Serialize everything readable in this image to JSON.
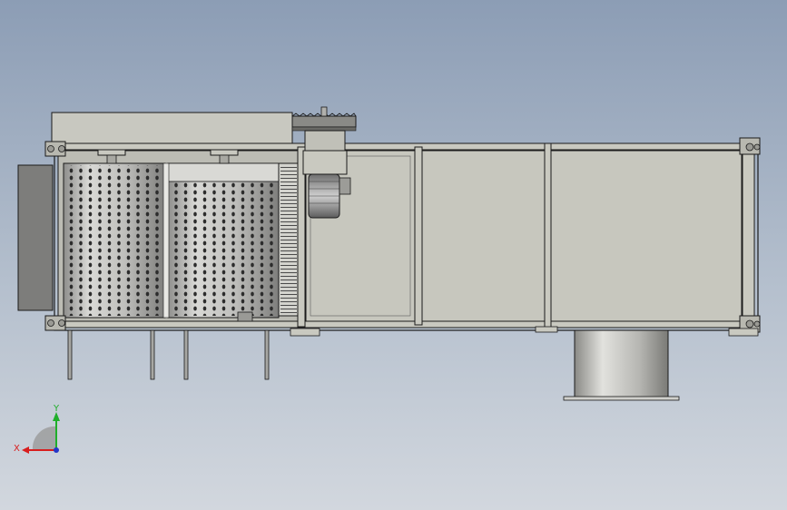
{
  "viewport": {
    "background_top": "#8c9db5",
    "background_bottom": "#d2d7de"
  },
  "model": {
    "frame_color": "#c9c9c0",
    "panel_color": "#c7c7be",
    "outline_color": "#1a1a1a",
    "drum_color": "#b9b9b6",
    "hole_color": "#2c2c2c",
    "pipe_color": "#a7a7a3"
  },
  "triad": {
    "x_label": "X",
    "y_label": "Y",
    "x_color": "#d81e1e",
    "y_color": "#1fae2a",
    "z_color": "#2436c8"
  }
}
